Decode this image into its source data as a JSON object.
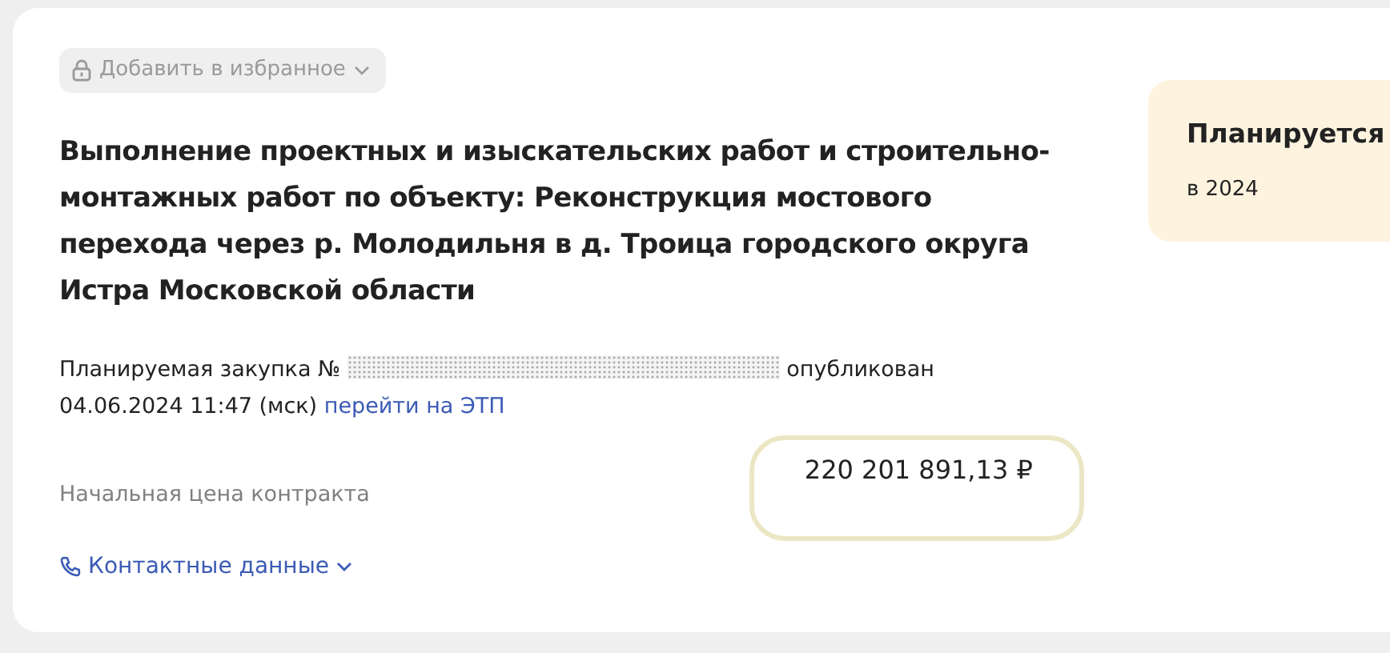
{
  "favorite_button": {
    "label": "Добавить в избранное",
    "disabled": true
  },
  "title": "Выполнение проектных и изыскательских работ и строительно-монтажных работ по объекту: Реконструкция мостового перехода через р. Молодильня в д. Троица городского округа Истра Московской области",
  "publication": {
    "prefix": "Планируемая закупка №",
    "number_redacted": true,
    "status_word": "опубликован",
    "date": "04.06.2024 11:47 (мск)",
    "link": "перейти на ЭТП"
  },
  "price": {
    "label": "Начальная цена контракта",
    "value": "220 201 891,13 ₽",
    "highlighted": true
  },
  "contacts_link": "Контактные данные",
  "status": {
    "title": "Планируется",
    "subtitle": "в 2024"
  }
}
